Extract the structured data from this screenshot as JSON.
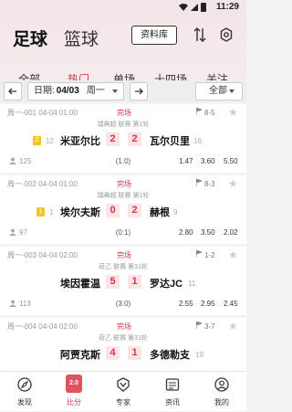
{
  "status_bar": {
    "time": "11:29"
  },
  "header": {
    "tab_football": "足球",
    "tab_basketball": "篮球",
    "data_library": "资料库"
  },
  "subtabs": [
    "全部",
    "热门",
    "单场",
    "十四场",
    "关注"
  ],
  "date_bar": {
    "date_label": "日期:",
    "date_value": "04/03",
    "weekday": "周一",
    "filter": "全部"
  },
  "matches": [
    {
      "code": "周一-001",
      "time": "04-04 01:00",
      "status": "完场",
      "half_count": "8-5",
      "league": "瑞典超 联赛 第1轮",
      "home_rank": "12",
      "home": "米亚尔比",
      "home_score": "2",
      "away_score": "2",
      "away": "瓦尔贝里",
      "away_rank": "16",
      "home_badge": "2",
      "away_badge": "",
      "views": "125",
      "halftime": "(1:0)",
      "odds": [
        "1.47",
        "3.60",
        "5.50"
      ]
    },
    {
      "code": "周一-002",
      "time": "04-04 01:00",
      "status": "完场",
      "half_count": "8-3",
      "league": "瑞典超 联赛 第1轮",
      "home_rank": "1",
      "home": "埃尔夫斯",
      "home_score": "0",
      "away_score": "2",
      "away": "赫根",
      "away_rank": "9",
      "home_badge": "1",
      "away_badge": "",
      "views": "97",
      "halftime": "(0:1)",
      "odds": [
        "2.80",
        "3.50",
        "2.02"
      ]
    },
    {
      "code": "周一-003",
      "time": "04-04 02:00",
      "status": "完场",
      "half_count": "1-2",
      "league": "荷乙 联赛 第31轮",
      "home_rank": "",
      "home": "埃因霍温",
      "home_score": "5",
      "away_score": "1",
      "away": "罗达JC",
      "away_rank": "11",
      "home_badge": "",
      "away_badge": "",
      "views": "113",
      "halftime": "(3:0)",
      "odds": [
        "2.55",
        "2.95",
        "2.45"
      ]
    },
    {
      "code": "周一-004",
      "time": "04-04 02:00",
      "status": "完场",
      "half_count": "3-7",
      "league": "荷乙 联赛 第31轮",
      "home_rank": "",
      "home": "阿贾克斯",
      "home_score": "4",
      "away_score": "1",
      "away": "多德勒支",
      "away_rank": "19",
      "home_badge": "",
      "away_badge": "",
      "views": "",
      "halftime": "",
      "odds": [
        "",
        "",
        ""
      ]
    }
  ],
  "bottom_nav": [
    {
      "label": "发现",
      "icon": "discover-icon"
    },
    {
      "label": "比分",
      "icon": "score-icon",
      "active_text": "2.0"
    },
    {
      "label": "专家",
      "icon": "expert-icon"
    },
    {
      "label": "资讯",
      "icon": "news-icon"
    },
    {
      "label": "我的",
      "icon": "profile-icon"
    }
  ],
  "colors": {
    "accent": "#d2374a",
    "badge": "#f4c326"
  }
}
